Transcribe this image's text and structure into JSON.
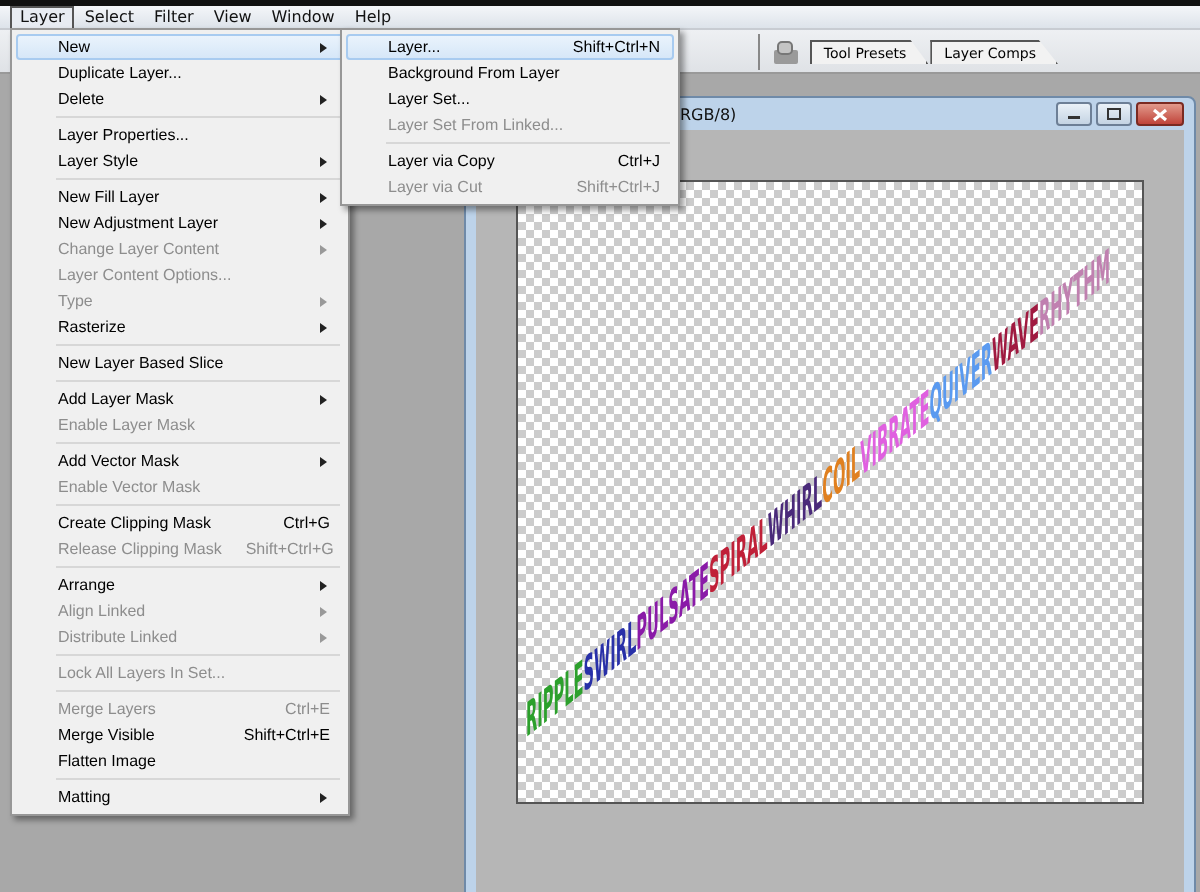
{
  "menu_bar": {
    "items": [
      {
        "label": "Layer",
        "selected": true
      },
      {
        "label": "Select",
        "selected": false
      },
      {
        "label": "Filter",
        "selected": false
      },
      {
        "label": "View",
        "selected": false
      },
      {
        "label": "Window",
        "selected": false
      },
      {
        "label": "Help",
        "selected": false
      }
    ]
  },
  "options_bar": {
    "palette_tabs": [
      {
        "label": "Tool Presets"
      },
      {
        "label": "Layer Comps"
      }
    ]
  },
  "layer_menu": {
    "items": [
      {
        "kind": "item",
        "label": "New",
        "submenu": true,
        "disabled": false,
        "selected": true
      },
      {
        "kind": "item",
        "label": "Duplicate Layer...",
        "submenu": false,
        "disabled": false,
        "selected": false
      },
      {
        "kind": "item",
        "label": "Delete",
        "submenu": true,
        "disabled": false,
        "selected": false
      },
      {
        "kind": "separator"
      },
      {
        "kind": "item",
        "label": "Layer Properties...",
        "submenu": false,
        "disabled": false,
        "selected": false
      },
      {
        "kind": "item",
        "label": "Layer Style",
        "submenu": true,
        "disabled": false,
        "selected": false
      },
      {
        "kind": "separator"
      },
      {
        "kind": "item",
        "label": "New Fill Layer",
        "submenu": true,
        "disabled": false,
        "selected": false
      },
      {
        "kind": "item",
        "label": "New Adjustment Layer",
        "submenu": true,
        "disabled": false,
        "selected": false
      },
      {
        "kind": "item",
        "label": "Change Layer Content",
        "submenu": true,
        "disabled": true,
        "selected": false
      },
      {
        "kind": "item",
        "label": "Layer Content Options...",
        "submenu": false,
        "disabled": true,
        "selected": false
      },
      {
        "kind": "item",
        "label": "Type",
        "submenu": true,
        "disabled": true,
        "selected": false
      },
      {
        "kind": "item",
        "label": "Rasterize",
        "submenu": true,
        "disabled": false,
        "selected": false
      },
      {
        "kind": "separator"
      },
      {
        "kind": "item",
        "label": "New Layer Based Slice",
        "submenu": false,
        "disabled": false,
        "selected": false
      },
      {
        "kind": "separator"
      },
      {
        "kind": "item",
        "label": "Add Layer Mask",
        "submenu": true,
        "disabled": false,
        "selected": false
      },
      {
        "kind": "item",
        "label": "Enable Layer Mask",
        "submenu": false,
        "disabled": true,
        "selected": false
      },
      {
        "kind": "separator"
      },
      {
        "kind": "item",
        "label": "Add Vector Mask",
        "submenu": true,
        "disabled": false,
        "selected": false
      },
      {
        "kind": "item",
        "label": "Enable Vector Mask",
        "submenu": false,
        "disabled": true,
        "selected": false
      },
      {
        "kind": "separator"
      },
      {
        "kind": "item",
        "label": "Create Clipping Mask",
        "shortcut": "Ctrl+G",
        "submenu": false,
        "disabled": false,
        "selected": false
      },
      {
        "kind": "item",
        "label": "Release Clipping Mask",
        "shortcut": "Shift+Ctrl+G",
        "submenu": false,
        "disabled": true,
        "selected": false
      },
      {
        "kind": "separator"
      },
      {
        "kind": "item",
        "label": "Arrange",
        "submenu": true,
        "disabled": false,
        "selected": false
      },
      {
        "kind": "item",
        "label": "Align Linked",
        "submenu": true,
        "disabled": true,
        "selected": false
      },
      {
        "kind": "item",
        "label": "Distribute Linked",
        "submenu": true,
        "disabled": true,
        "selected": false
      },
      {
        "kind": "separator"
      },
      {
        "kind": "item",
        "label": "Lock All Layers In Set...",
        "submenu": false,
        "disabled": true,
        "selected": false
      },
      {
        "kind": "separator"
      },
      {
        "kind": "item",
        "label": "Merge Layers",
        "shortcut": "Ctrl+E",
        "submenu": false,
        "disabled": true,
        "selected": false
      },
      {
        "kind": "item",
        "label": "Merge Visible",
        "shortcut": "Shift+Ctrl+E",
        "submenu": false,
        "disabled": false,
        "selected": false
      },
      {
        "kind": "item",
        "label": "Flatten Image",
        "submenu": false,
        "disabled": false,
        "selected": false
      },
      {
        "kind": "separator"
      },
      {
        "kind": "item",
        "label": "Matting",
        "submenu": true,
        "disabled": false,
        "selected": false
      }
    ]
  },
  "new_submenu": {
    "items": [
      {
        "kind": "item",
        "label": "Layer...",
        "shortcut": "Shift+Ctrl+N",
        "disabled": false,
        "selected": true
      },
      {
        "kind": "item",
        "label": "Background From Layer",
        "disabled": false,
        "selected": false
      },
      {
        "kind": "item",
        "label": "Layer Set...",
        "disabled": false,
        "selected": false
      },
      {
        "kind": "item",
        "label": "Layer Set From Linked...",
        "disabled": true,
        "selected": false
      },
      {
        "kind": "separator"
      },
      {
        "kind": "item",
        "label": "Layer via Copy",
        "shortcut": "Ctrl+J",
        "disabled": false,
        "selected": false
      },
      {
        "kind": "item",
        "label": "Layer via Cut",
        "shortcut": "Shift+Ctrl+J",
        "disabled": true,
        "selected": false
      }
    ]
  },
  "document_window": {
    "title": "RGB/8)",
    "canvas_words": [
      {
        "text": "RIPPLE",
        "color": "#2ca02c"
      },
      {
        "text": "SWIRL",
        "color": "#2830a8"
      },
      {
        "text": "PULSATE",
        "color": "#8a1aa8"
      },
      {
        "text": "SPIRAL",
        "color": "#c02038"
      },
      {
        "text": "WHIRL",
        "color": "#4a2a7a"
      },
      {
        "text": "COIL",
        "color": "#e08020"
      },
      {
        "text": "VIBRATE",
        "color": "#e060e0"
      },
      {
        "text": "QUIVER",
        "color": "#5a9af0"
      },
      {
        "text": "WAVE",
        "color": "#a01a40"
      },
      {
        "text": "RHYTHM",
        "color": "#c080b0"
      }
    ]
  }
}
